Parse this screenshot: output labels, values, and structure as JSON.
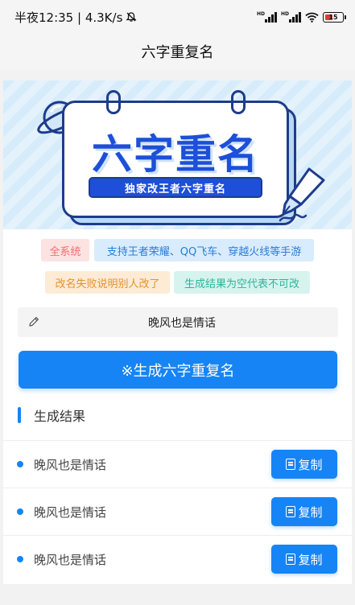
{
  "status": {
    "time": "半夜12:35 | 4.3K/s",
    "battery": "15"
  },
  "header": {
    "title": "六字重复名"
  },
  "banner": {
    "title": "六字重名",
    "subtitle": "独家改王者六字重名"
  },
  "tags": [
    {
      "label": "全系统"
    },
    {
      "label": "支持王者荣耀、QQ飞车、穿越火线等手游"
    },
    {
      "label": "改名失败说明别人改了"
    },
    {
      "label": "生成结果为空代表不可改"
    }
  ],
  "input": {
    "value": "晚风也是情话",
    "placeholder": ""
  },
  "generate_button": {
    "label": "※生成六字重复名"
  },
  "results": {
    "title": "生成结果",
    "items": [
      {
        "text": "晚风也是情话",
        "copy_label": "复制"
      },
      {
        "text": "晚风也是情话",
        "copy_label": "复制"
      },
      {
        "text": "晚风也是情话",
        "copy_label": "复制"
      }
    ]
  },
  "colors": {
    "accent": "#1684f5",
    "banner_title": "#1d4fd8"
  }
}
